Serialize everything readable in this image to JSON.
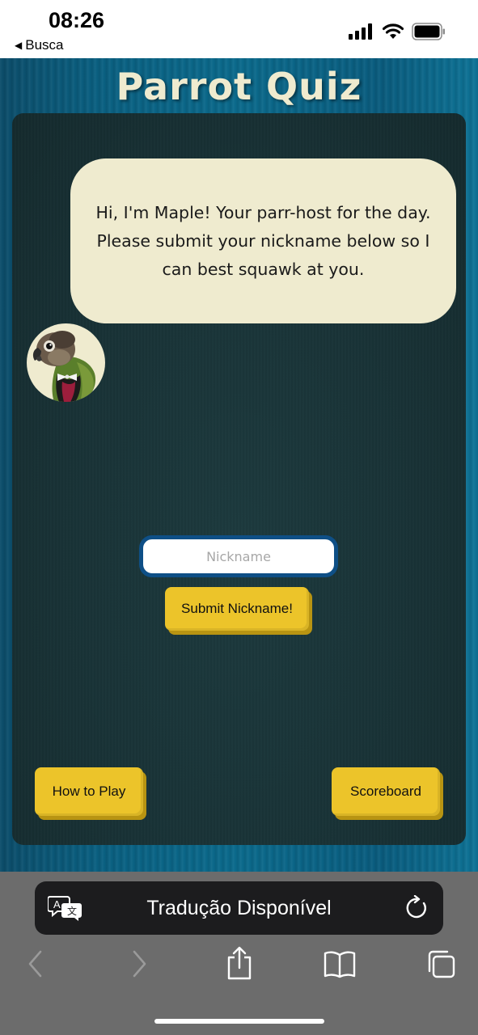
{
  "status_bar": {
    "time": "08:26",
    "back_app": "Busca",
    "icons": [
      "signal-icon",
      "wifi-icon",
      "battery-icon"
    ]
  },
  "page": {
    "title": "Parrot Quiz",
    "bubble": {
      "line1": "Hi, I'm Maple! Your parr-host for the day.",
      "line2": "Please submit your nickname below so I",
      "line3": "can best squawk at you."
    },
    "nickname_input": {
      "placeholder": "Nickname",
      "value": ""
    },
    "submit_label": "Submit Nickname!",
    "how_to_play_label": "How to Play",
    "scoreboard_label": "Scoreboard",
    "colors": {
      "accent": "#ecc42a",
      "bubble": "#efebcf",
      "input_border": "#0e4f86"
    }
  },
  "safari": {
    "translation_banner": "Tradução Disponível",
    "toolbar_icons": [
      "back-icon",
      "forward-icon",
      "share-icon",
      "bookmarks-icon",
      "tabs-icon"
    ]
  }
}
